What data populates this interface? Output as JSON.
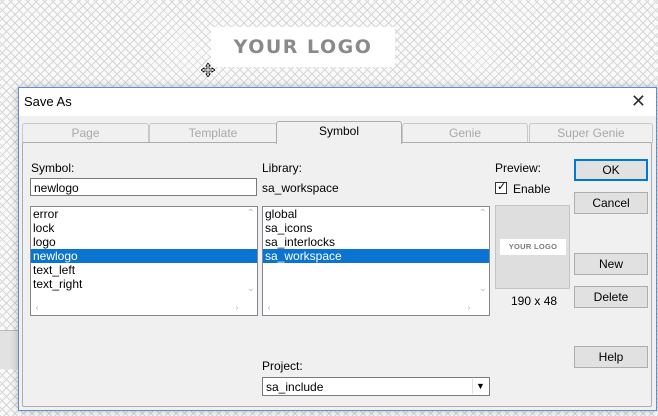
{
  "canvas": {
    "logo_text": "YOUR LOGO"
  },
  "dialog": {
    "title": "Save As",
    "tabs": [
      {
        "label": "Page",
        "active": false
      },
      {
        "label": "Template",
        "active": false
      },
      {
        "label": "Symbol",
        "active": true
      },
      {
        "label": "Genie",
        "active": false
      },
      {
        "label": "Super Genie",
        "active": false
      }
    ],
    "symbol": {
      "label": "Symbol:",
      "value": "newlogo",
      "items": [
        "error",
        "lock",
        "logo",
        "newlogo",
        "text_left",
        "text_right"
      ],
      "selected": "newlogo"
    },
    "library": {
      "label": "Library:",
      "value": "sa_workspace",
      "items": [
        "global",
        "sa_icons",
        "sa_interlocks",
        "sa_workspace"
      ],
      "selected": "sa_workspace"
    },
    "preview": {
      "label": "Preview:",
      "enable_label": "Enable",
      "enable_checked": true,
      "logo_text": "YOUR LOGO",
      "size_text": "190 x 48"
    },
    "project": {
      "label": "Project:",
      "value": "sa_include"
    },
    "buttons": {
      "ok": "OK",
      "cancel": "Cancel",
      "new": "New",
      "delete": "Delete",
      "help": "Help"
    }
  }
}
